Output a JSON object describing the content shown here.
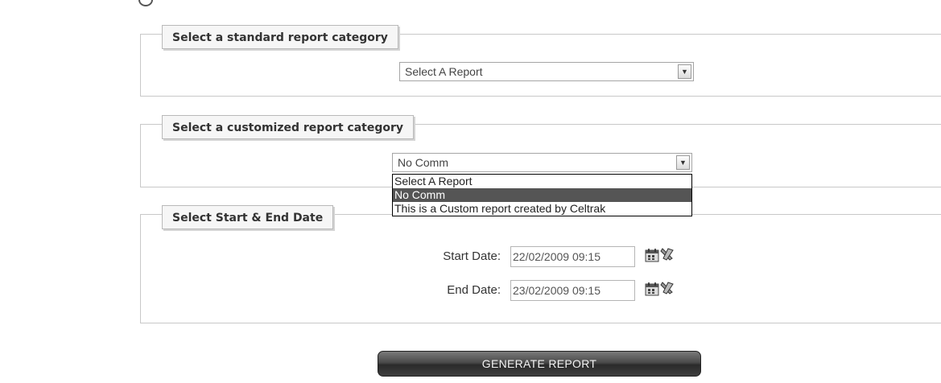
{
  "standard_section": {
    "legend": "Select a standard report category",
    "select_value": "Select A Report"
  },
  "custom_section": {
    "legend": "Select a customized report category",
    "select_value": "No Comm",
    "options": [
      {
        "label": "Select A Report",
        "selected": false
      },
      {
        "label": "No Comm",
        "selected": true
      },
      {
        "label": "This is a Custom report created by Celtrak",
        "selected": false
      }
    ]
  },
  "date_section": {
    "legend": "Select Start & End Date",
    "start_label": "Start Date:",
    "start_value": "22/02/2009 09:15",
    "end_label": "End Date:",
    "end_value": "23/02/2009 09:15"
  },
  "actions": {
    "generate_label": "GENERATE REPORT"
  },
  "icons": {
    "calendar": "calendar-icon",
    "clear": "clear-date-icon",
    "dropdown": "chevron-down-icon"
  },
  "colors": {
    "highlight": "#555555",
    "button": "#3d3d3d"
  }
}
